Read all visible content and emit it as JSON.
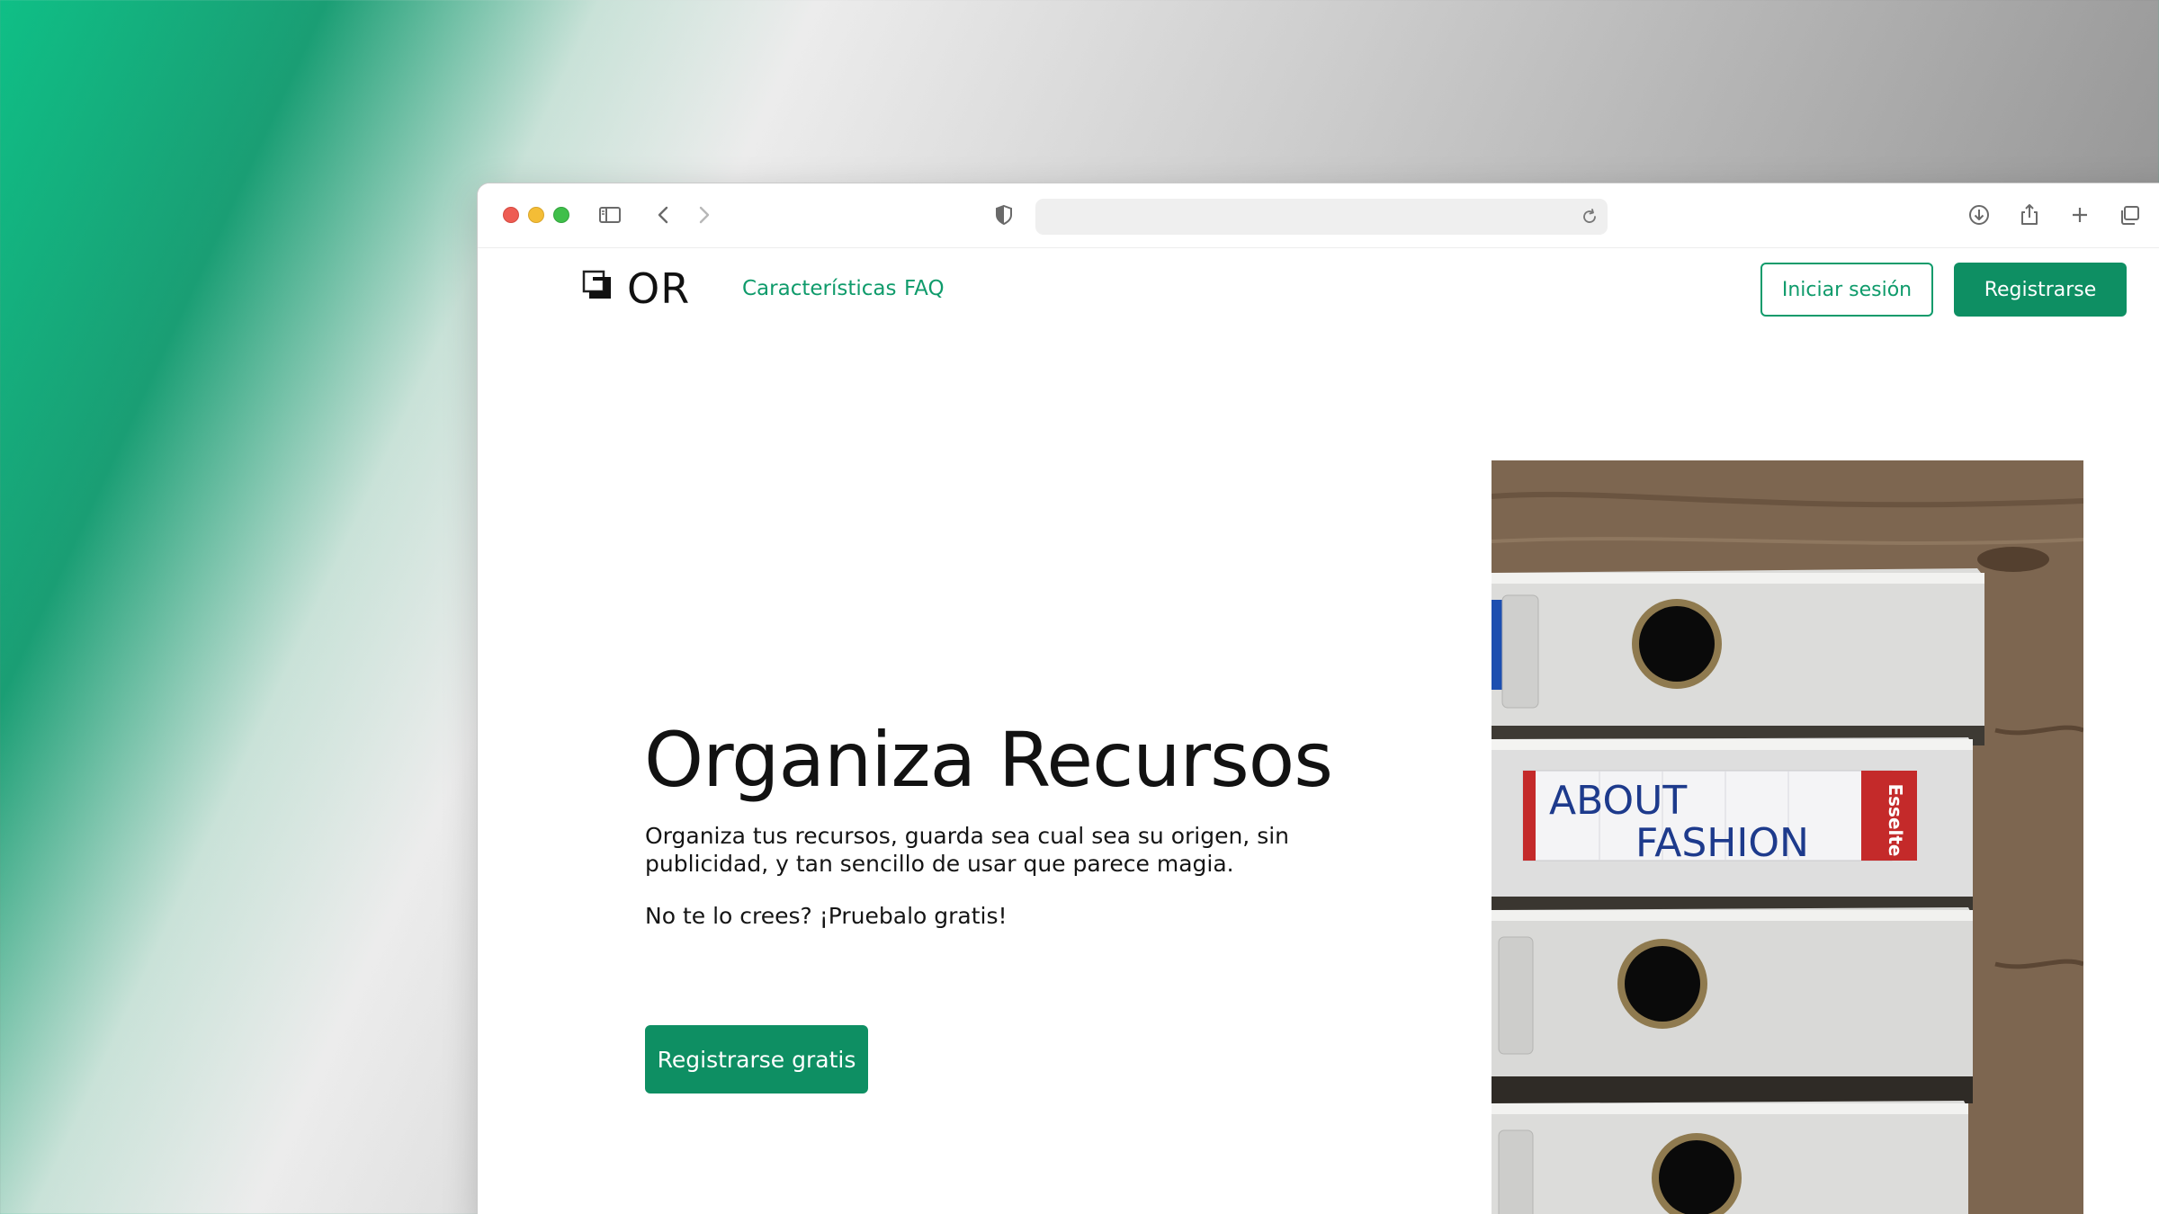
{
  "browser": {
    "address_value": ""
  },
  "site": {
    "logo_text": "OR",
    "nav": [
      {
        "label": "Características"
      },
      {
        "label": "FAQ"
      }
    ],
    "login_label": "Iniciar sesión",
    "register_label": "Registrarse"
  },
  "hero": {
    "title": "Organiza Recursos",
    "description": "Organiza tus recursos, guarda sea cual sea su origen, sin publicidad, y tan sencillo de usar que parece magia.",
    "subtext": "No te lo crees? ¡Pruebalo gratis!",
    "cta_label": "Registrarse gratis",
    "image_label_line1": "ABOUT",
    "image_label_line2": "FASHION",
    "image_brand": "Esselte"
  },
  "colors": {
    "accent": "#0e8f63",
    "accent_text": "#0f9b6b"
  },
  "icons": {
    "sidebar": "sidebar-icon",
    "back": "chevron-left-icon",
    "forward": "chevron-right-icon",
    "privacy": "shield-icon",
    "reload": "reload-icon",
    "download": "download-icon",
    "share": "share-icon",
    "new_tab": "plus-icon",
    "tabs": "tabs-overview-icon"
  }
}
